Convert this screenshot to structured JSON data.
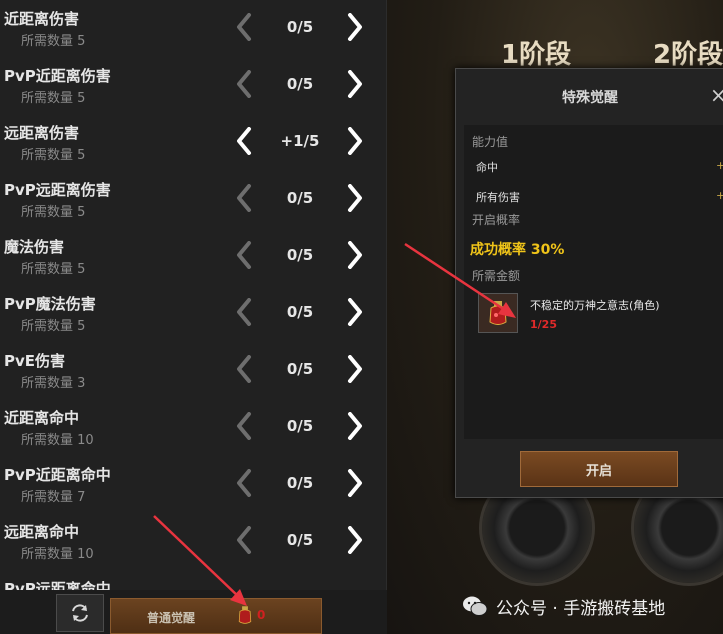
{
  "stats": [
    {
      "name": "近距离伤害",
      "req": "所需数量 5",
      "count": "0/5",
      "active": false
    },
    {
      "name": "PvP近距离伤害",
      "req": "所需数量 5",
      "count": "0/5",
      "active": false
    },
    {
      "name": "远距离伤害",
      "req": "所需数量 5",
      "count": "+1/5",
      "active": true
    },
    {
      "name": "PvP远距离伤害",
      "req": "所需数量 5",
      "count": "0/5",
      "active": false
    },
    {
      "name": "魔法伤害",
      "req": "所需数量 5",
      "count": "0/5",
      "active": false
    },
    {
      "name": "PvP魔法伤害",
      "req": "所需数量 5",
      "count": "0/5",
      "active": false
    },
    {
      "name": "PvE伤害",
      "req": "所需数量 3",
      "count": "0/5",
      "active": false
    },
    {
      "name": "近距离命中",
      "req": "所需数量 10",
      "count": "0/5",
      "active": false
    },
    {
      "name": "PvP近距离命中",
      "req": "所需数量 7",
      "count": "0/5",
      "active": false
    },
    {
      "name": "远距离命中",
      "req": "所需数量 10",
      "count": "0/5",
      "active": false
    },
    {
      "name": "PvP远距离命中",
      "req": "",
      "count": "",
      "active": false
    }
  ],
  "stages": [
    "1阶段",
    "2阶段"
  ],
  "dialog": {
    "title": "特殊觉醒",
    "close_icon": "×",
    "ability_label": "能力值",
    "abilities": [
      {
        "name": "命中",
        "plus": "+"
      },
      {
        "name": "所有伤害",
        "plus": "+"
      }
    ],
    "open_rate_label": "开启概率",
    "success_rate": "成功概率 30%",
    "cost_label": "所需金额",
    "item_name": "不稳定的万神之意志(角色)",
    "item_qty": "1/25",
    "open_button": "开启"
  },
  "bottom": {
    "awaken_label": "普通觉醒",
    "awaken_cost": "0"
  },
  "watermark": "公众号 · 手游搬砖基地",
  "colors": {
    "accent_gold": "#f0c419",
    "cost_red": "#e02a2a",
    "button_brown": "#6b4320",
    "annotation_red": "#e8343f"
  },
  "icons": {
    "left_arrow": "chevron-left-icon",
    "right_arrow": "chevron-right-icon",
    "refresh": "refresh-icon",
    "item": "red-potion-icon",
    "wechat": "wechat-icon"
  }
}
